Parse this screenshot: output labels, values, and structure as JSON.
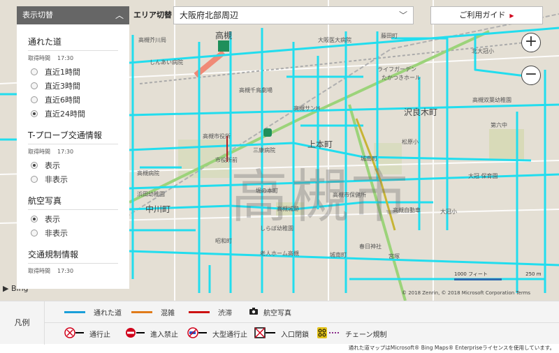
{
  "panel": {
    "toggle_label": "表示切替",
    "sections": {
      "roads": {
        "title": "通れた道",
        "acq_label": "取得時間",
        "acq_time": "17:30",
        "options": [
          {
            "label": "直近1時間",
            "selected": false
          },
          {
            "label": "直近3時間",
            "selected": false
          },
          {
            "label": "直近6時間",
            "selected": false
          },
          {
            "label": "直近24時間",
            "selected": true
          }
        ]
      },
      "probe": {
        "title": "T-プローブ交通情報",
        "acq_label": "取得時間",
        "acq_time": "17:30",
        "options": [
          {
            "label": "表示",
            "selected": true
          },
          {
            "label": "非表示",
            "selected": false
          }
        ]
      },
      "aerial": {
        "title": "航空写真",
        "options": [
          {
            "label": "表示",
            "selected": true
          },
          {
            "label": "非表示",
            "selected": false
          }
        ]
      },
      "regulation": {
        "title": "交通規制情報",
        "acq_label": "取得時間",
        "acq_time": "17:30"
      }
    }
  },
  "topbar": {
    "area_label": "エリア切替",
    "area_value": "大阪府北部周辺",
    "guide_label": "ご利用ガイド"
  },
  "zoom": {
    "plus": "+",
    "minus": "−"
  },
  "map": {
    "watermark": "高槻市",
    "labels": [
      "高槻芥川局",
      "しんあい病院",
      "高槻",
      "大阪医大病院",
      "藤田町",
      "北大冠小",
      "ライフガーデン",
      "たかつきホール",
      "高槻千鳥劇場",
      "高槻サンH",
      "高槻双葉幼稚園",
      "沢良木町",
      "高槻市役所",
      "上本町",
      "第六中",
      "三康病院",
      "市役所前",
      "松原小",
      "城南町",
      "高槻病院",
      "大冠 保育園",
      "堀の本町",
      "高槻市保健所",
      "高槻城跡",
      "浜田幼稚園",
      "中川町",
      "高槻自動車",
      "大冠小",
      "しらぼ幼稚園",
      "老人ホーム高槻",
      "城南町",
      "春日神社",
      "昭和町",
      "宮塚"
    ],
    "copyright": "© 2018 Zenrin, © 2018 Microsoft Corporation  Terms",
    "scale_ft": "1000 フィート",
    "scale_m": "250 m",
    "bing": "Bing"
  },
  "legend": {
    "title": "凡例",
    "lines": [
      {
        "label": "通れた道",
        "color": "#1a9fd9"
      },
      {
        "label": "混雑",
        "color": "#e07b1a"
      },
      {
        "label": "渋滞",
        "color": "#cc1111"
      }
    ],
    "photo_label": "航空写真",
    "symbols": [
      "通行止",
      "進入禁止",
      "大型通行止",
      "入口閉鎖",
      "チェーン規制"
    ]
  },
  "footer": "通れた道マップはMicrosoft® Bing Maps® Enterpriseライセンスを使用しています。"
}
